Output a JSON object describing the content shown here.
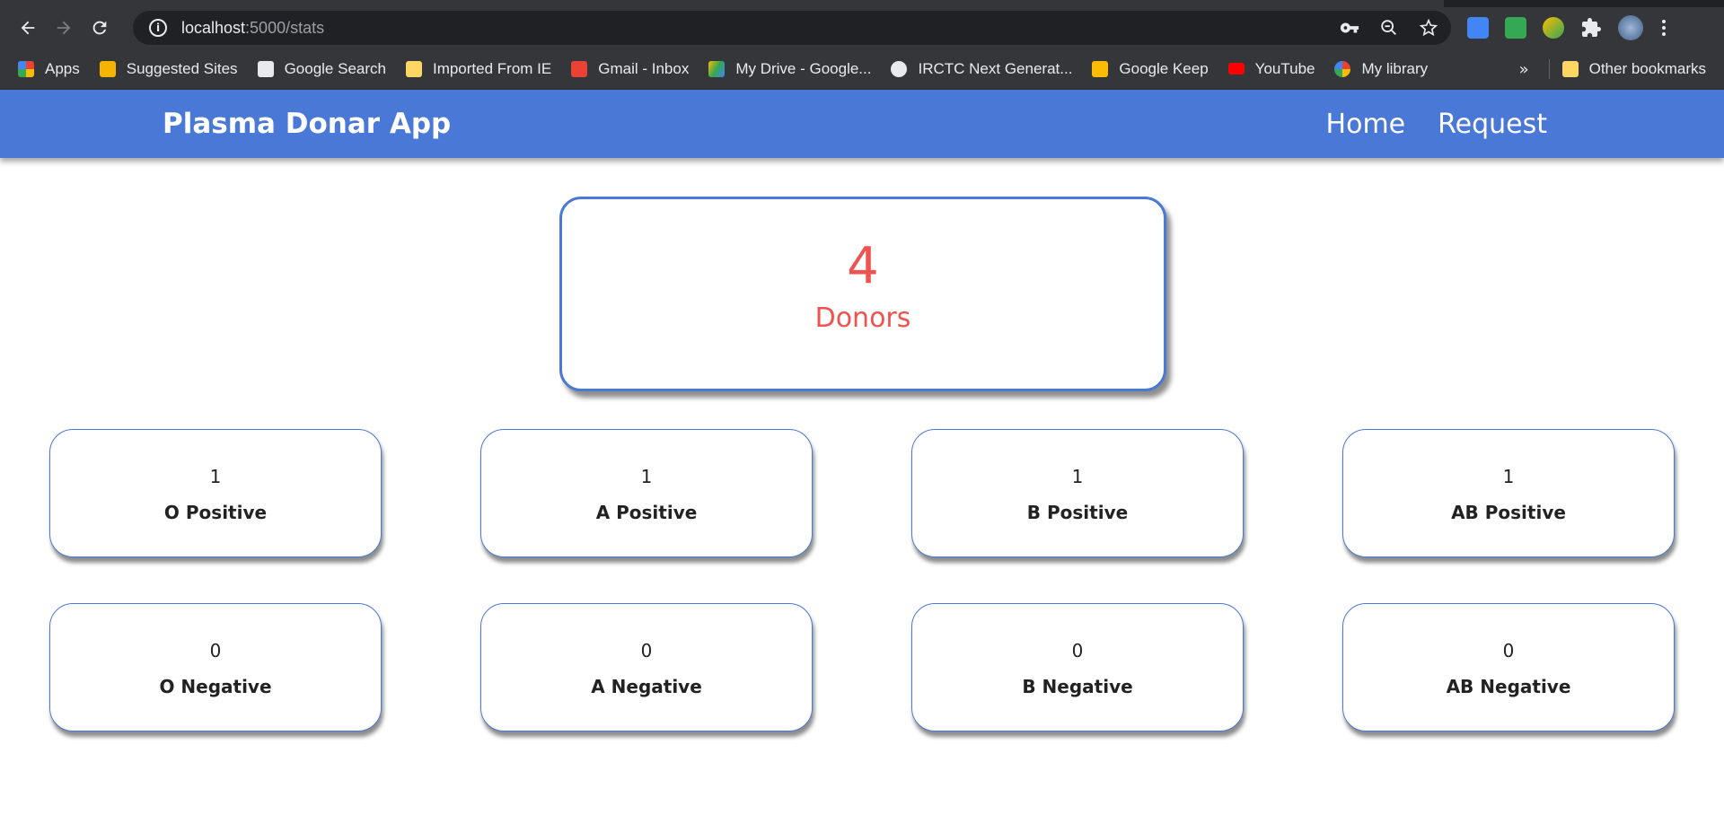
{
  "browser": {
    "url_host": "localhost",
    "url_path": ":5000/stats",
    "bookmarks": [
      {
        "label": "Apps",
        "icon": "apps-grid-icon",
        "color": "#ea4335"
      },
      {
        "label": "Suggested Sites",
        "icon": "bing-icon",
        "color": "#f4b400"
      },
      {
        "label": "Google Search",
        "icon": "home-icon",
        "color": "#e8eaed"
      },
      {
        "label": "Imported From IE",
        "icon": "folder-icon",
        "color": "#fdd663"
      },
      {
        "label": "Gmail - Inbox",
        "icon": "gmail-icon",
        "color": "#ea4335"
      },
      {
        "label": "My Drive - Google...",
        "icon": "drive-icon",
        "color": "#34a853"
      },
      {
        "label": "IRCTC Next Generat...",
        "icon": "globe-icon",
        "color": "#e8eaed"
      },
      {
        "label": "Google Keep",
        "icon": "keep-icon",
        "color": "#fbbc04"
      },
      {
        "label": "YouTube",
        "icon": "youtube-icon",
        "color": "#ff0000"
      },
      {
        "label": "My library",
        "icon": "google-icon",
        "color": "#4285f4"
      }
    ],
    "overflow": "»",
    "other_bookmarks": "Other bookmarks"
  },
  "navbar": {
    "brand": "Plasma Donar App",
    "links": [
      "Home",
      "Request"
    ]
  },
  "stats": {
    "total": {
      "value": "4",
      "label": "Donors"
    },
    "groups": [
      {
        "value": "1",
        "label": "O Positive"
      },
      {
        "value": "1",
        "label": "A Positive"
      },
      {
        "value": "1",
        "label": "B Positive"
      },
      {
        "value": "1",
        "label": "AB Positive"
      },
      {
        "value": "0",
        "label": "O Negative"
      },
      {
        "value": "0",
        "label": "A Negative"
      },
      {
        "value": "0",
        "label": "B Negative"
      },
      {
        "value": "0",
        "label": "AB Negative"
      }
    ]
  },
  "colors": {
    "navbar": "#4a78d6",
    "accent_red": "#ef5350",
    "card_border": "#4a78d6"
  }
}
